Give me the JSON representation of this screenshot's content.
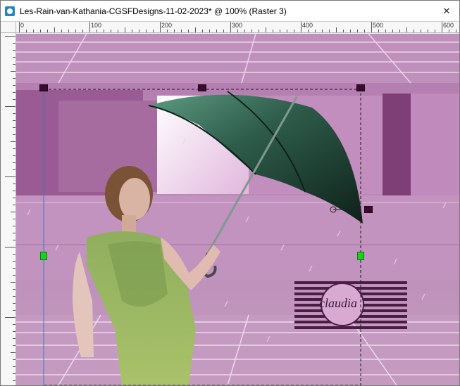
{
  "window": {
    "title": "Les-Rain-van-Kathania-CGSFDesigns-11-02-2023* @ 100% (Raster 3)",
    "close_glyph": "✕",
    "app_icon": "paintshop-icon"
  },
  "ruler": {
    "h_labels": [
      "0",
      "100",
      "200",
      "300",
      "400",
      "500",
      "600"
    ]
  },
  "canvas": {
    "watermark": "claudia",
    "colors": {
      "floor": "#c99ac5",
      "wall_dark": "#8c4d86",
      "wall_mid": "#b37ab0",
      "light_panel": "#f2d7f0",
      "umbrella": "#1f4a3a",
      "handle_dark": "#3b0a2e",
      "handle_green": "#19d11c"
    }
  }
}
